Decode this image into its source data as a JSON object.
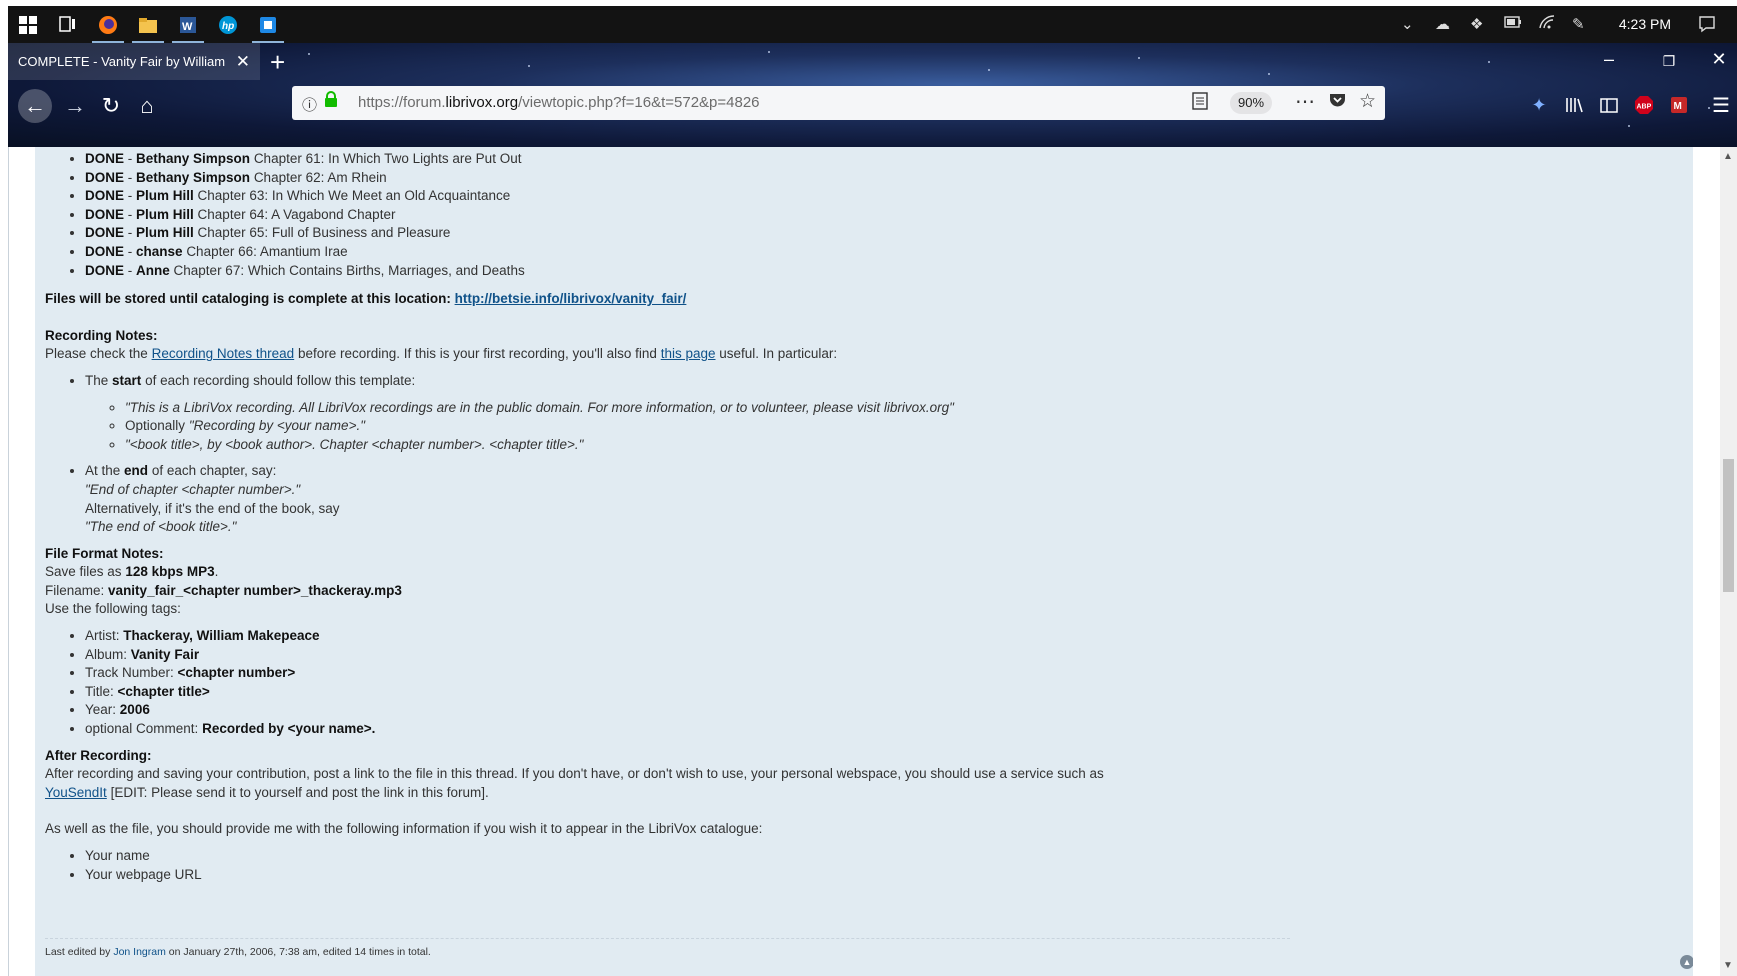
{
  "taskbar": {
    "clock": "4:23 PM",
    "icons": [
      "windows-start-icon",
      "task-view-icon",
      "firefox-icon",
      "file-explorer-icon",
      "word-icon",
      "hp-icon",
      "app-icon"
    ],
    "tray": [
      "chevron-up-icon",
      "onedrive-icon",
      "dropbox-icon",
      "battery-icon",
      "wifi-icon",
      "pen-icon",
      "notifications-icon"
    ]
  },
  "browser": {
    "tab_title": "COMPLETE - Vanity Fair by William",
    "url_prefix": "https://forum.",
    "url_domain": "librivox.org",
    "url_path": "/viewtopic.php?f=16&t=572&p=4826",
    "zoom": "90%"
  },
  "post": {
    "done_items": [
      {
        "status": "DONE",
        "reader": "Bethany Simpson",
        "chapter": "Chapter 61: In Which Two Lights are Put Out"
      },
      {
        "status": "DONE",
        "reader": "Bethany Simpson",
        "chapter": "Chapter 62: Am Rhein"
      },
      {
        "status": "DONE",
        "reader": "Plum Hill",
        "chapter": "Chapter 63: In Which We Meet an Old Acquaintance"
      },
      {
        "status": "DONE",
        "reader": "Plum Hill",
        "chapter": "Chapter 64: A Vagabond Chapter"
      },
      {
        "status": "DONE",
        "reader": "Plum Hill",
        "chapter": "Chapter 65: Full of Business and Pleasure"
      },
      {
        "status": "DONE",
        "reader": "chanse",
        "chapter": "Chapter 66: Amantium Irae"
      },
      {
        "status": "DONE",
        "reader": "Anne",
        "chapter": "Chapter 67: Which Contains Births, Marriages, and Deaths"
      }
    ],
    "files_note": "Files will be stored until cataloging is complete at this location:",
    "files_link": "http://betsie.info/librivox/vanity_fair/",
    "recording_notes_heading": "Recording Notes:",
    "recording_intro_1": "Please check the",
    "recording_notes_link": "Recording Notes thread",
    "recording_intro_2": "before recording. If this is your first recording, you'll also find",
    "this_page_link": "this page",
    "recording_intro_3": "useful. In particular:",
    "start_pre": "The",
    "start_bold": "start",
    "start_post": "of each recording should follow this template:",
    "template_1": "\"This is a LibriVox recording. All LibriVox recordings are in the public domain. For more information, or to volunteer, please visit librivox.org\"",
    "template_2_pre": "Optionally",
    "template_2_italic": "\"Recording by <your name>.\"",
    "template_3": "\"<book title>, by <book author>. Chapter <chapter number>. <chapter title>.\"",
    "end_pre": "At the",
    "end_bold": "end",
    "end_post": "of each chapter, say:",
    "end_line_1": "\"End of chapter <chapter number>.\"",
    "end_line_2": "Alternatively, if it's the end of the book, say",
    "end_line_3": "\"The end of <book title>.\"",
    "file_format_heading": "File Format Notes:",
    "save_pre": "Save files as",
    "save_bold": "128 kbps MP3",
    "save_post": ".",
    "filename_label": "Filename:",
    "filename_value": "vanity_fair_<chapter number>_thackeray.mp3",
    "tags_intro": "Use the following tags:",
    "tags": [
      {
        "label": "Artist:",
        "value": "Thackeray, William Makepeace"
      },
      {
        "label": "Album:",
        "value": "Vanity Fair"
      },
      {
        "label": "Track Number:",
        "value": "<chapter number>"
      },
      {
        "label": "Title:",
        "value": "<chapter title>"
      },
      {
        "label": "Year:",
        "value": "2006"
      },
      {
        "label": "optional Comment:",
        "value": "Recorded by <your name>."
      }
    ],
    "after_heading": "After Recording:",
    "after_text": "After recording and saving your contribution, post a link to the file in this thread. If you don't have, or don't wish to use, your personal webspace, you should use a service such as",
    "yousendit_link": "YouSendIt",
    "after_edit": "[EDIT: Please send it to yourself and post the link in this forum].",
    "catalog_text": "As well as the file, you should provide me with the following information if you wish it to appear in the LibriVox catalogue:",
    "catalog_items": [
      "Your name",
      "Your webpage URL"
    ],
    "footer_pre": "Last edited by",
    "footer_user": "Jon Ingram",
    "footer_post": "on January 27th, 2006, 7:38 am, edited 14 times in total."
  }
}
